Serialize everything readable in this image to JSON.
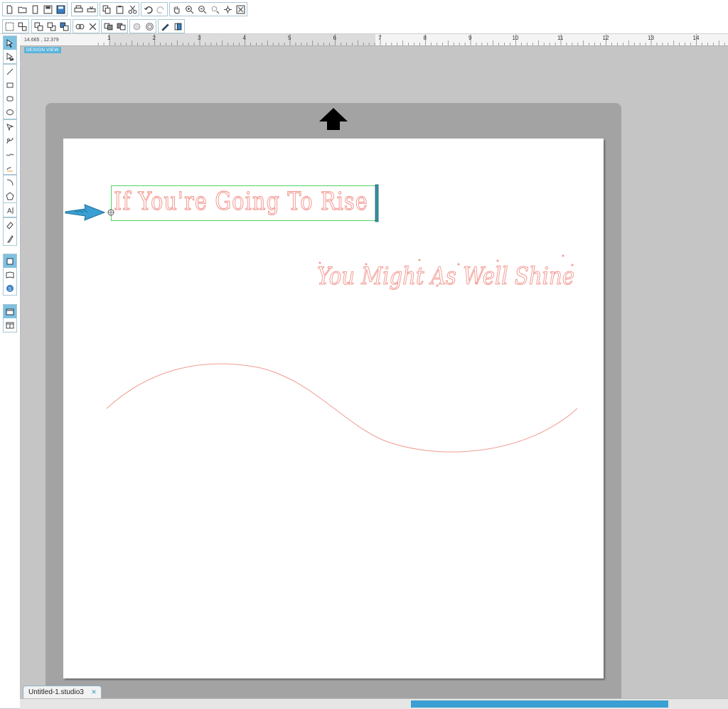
{
  "window": {
    "document_tab": "Untitled-1.studio3",
    "tab_close_icon": "close-x-icon"
  },
  "toolbar_top": {
    "icons": [
      "new-document-icon",
      "open-folder-icon",
      "open-file-icon",
      "save-icon",
      "save-as-icon",
      "print-icon",
      "send-to-cutter-icon",
      "copy-icon",
      "paste-icon",
      "cut-icon",
      "undo-icon",
      "redo-icon",
      "pan-hand-icon",
      "zoom-in-icon",
      "zoom-out-icon",
      "zoom-selection-icon",
      "drag-zoom-icon",
      "fit-to-page-icon"
    ]
  },
  "toolbar_second": {
    "icons": [
      "group-icon",
      "ungroup-icon",
      "bring-forward-icon",
      "send-backward-icon",
      "duplicate-icon",
      "delete-icon",
      "paste-in-front-icon",
      "fill-icon",
      "line-style-icon",
      "weld-icon",
      "offset-icon",
      "trace-icon",
      "replicate-icon"
    ]
  },
  "left_tools": {
    "icons": [
      "select-icon",
      "point-edit-icon",
      "line-tool-icon",
      "rectangle-tool-icon",
      "rounded-rectangle-tool-icon",
      "ellipse-tool-icon",
      "polygon-tool-icon",
      "curve-tool-icon",
      "freehand-tool-icon",
      "smooth-freehand-tool-icon",
      "arc-tool-icon",
      "regular-polygon-tool-icon",
      "text-tool-icon",
      "eraser-tool-icon",
      "knife-tool-icon",
      "design-page-icon",
      "library-icon",
      "online-store-icon",
      "single-view-icon",
      "split-view-icon"
    ]
  },
  "ruler": {
    "coordinates": "14.665 , 12.379",
    "numbers": [
      "1",
      "2",
      "3",
      "4",
      "5",
      "6",
      "7",
      "8",
      "9",
      "10",
      "11",
      "12",
      "13",
      "14"
    ]
  },
  "view_badge": "DESIGN VIEW",
  "canvas": {
    "text1": "If You're Going To Rise",
    "text2": "You Might As Well Shine",
    "text_color": "#f29b94",
    "selection_color": "#4ed464",
    "arrow_color": "#3a9fd2",
    "curve_color": "#ef9b92"
  }
}
